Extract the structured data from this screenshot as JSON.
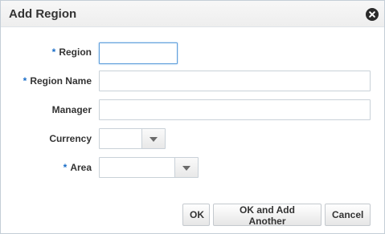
{
  "dialog": {
    "title": "Add Region"
  },
  "form": {
    "required_marker": "*",
    "region": {
      "label": "Region",
      "value": ""
    },
    "region_name": {
      "label": "Region Name",
      "value": ""
    },
    "manager": {
      "label": "Manager",
      "value": ""
    },
    "currency": {
      "label": "Currency",
      "value": ""
    },
    "area": {
      "label": "Area",
      "value": ""
    }
  },
  "buttons": {
    "ok": "OK",
    "ok_add_another": "OK and Add Another",
    "cancel": "Cancel"
  },
  "icons": {
    "close": "close-icon",
    "dropdown": "chevron-down-icon"
  }
}
